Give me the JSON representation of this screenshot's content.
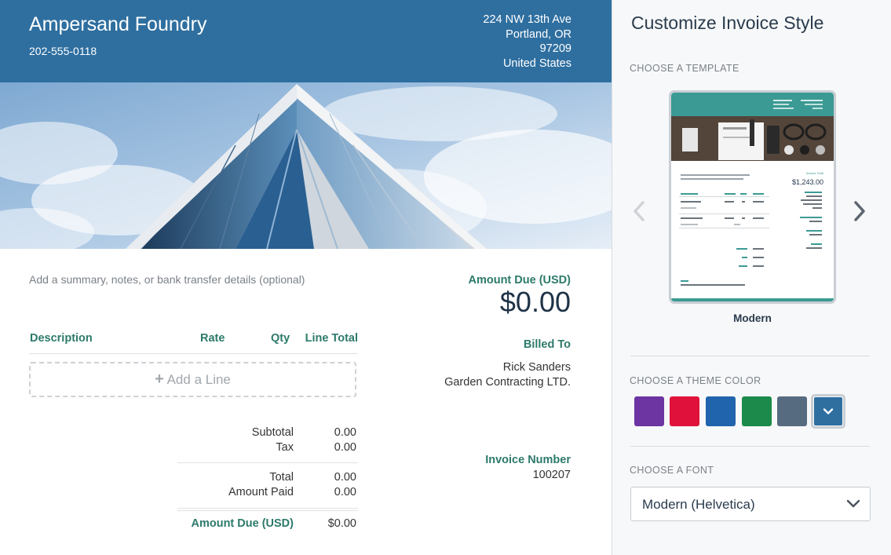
{
  "invoice": {
    "company_name": "Ampersand Foundry",
    "company_phone": "202-555-0118",
    "address": [
      "224 NW 13th Ave",
      "Portland, OR",
      "97209",
      "United States"
    ],
    "summary_placeholder": "Add a summary, notes, or bank transfer details (optional)",
    "amount_due_label": "Amount Due (USD)",
    "amount_due_value": "$0.00",
    "billed_to_label": "Billed To",
    "client_name": "Rick Sanders",
    "client_company": "Garden Contracting LTD.",
    "invoice_number_label": "Invoice Number",
    "invoice_number": "100207",
    "columns": {
      "description": "Description",
      "rate": "Rate",
      "qty": "Qty",
      "line_total": "Line Total"
    },
    "add_line_label": "Add a Line",
    "totals": {
      "subtotal_label": "Subtotal",
      "subtotal": "0.00",
      "tax_label": "Tax",
      "tax": "0.00",
      "total_label": "Total",
      "total": "0.00",
      "amount_paid_label": "Amount Paid",
      "amount_paid": "0.00",
      "amount_due_label": "Amount Due (USD)",
      "amount_due": "$0.00"
    },
    "header_color": "#2f6fa0",
    "accent_color": "#2d7a6b"
  },
  "panel": {
    "title": "Customize Invoice Style",
    "choose_template_label": "CHOOSE A TEMPLATE",
    "template_name": "Modern",
    "template_preview": {
      "amount": "$1,243.00"
    },
    "choose_color_label": "CHOOSE A THEME COLOR",
    "colors": [
      "#6c35a2",
      "#e0123c",
      "#1f64ad",
      "#1b8a4b",
      "#566b7f",
      "#2f6fa0"
    ],
    "selected_color_index": 5,
    "choose_font_label": "CHOOSE A FONT",
    "font_value": "Modern (Helvetica)"
  }
}
